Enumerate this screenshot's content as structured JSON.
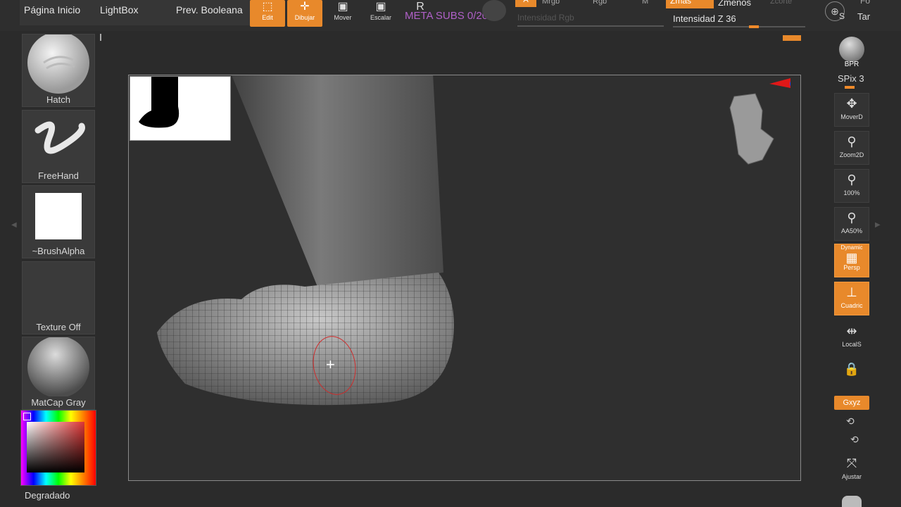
{
  "topbar": {
    "home_label": "Página Inicio",
    "lightbox_label": "LightBox",
    "bool_label": "Prev. Booleana",
    "tools": [
      {
        "label": "Edit",
        "icon": "edit-icon"
      },
      {
        "label": "Dibujar",
        "icon": "draw-icon"
      },
      {
        "label": "Mover",
        "icon": "move-icon"
      },
      {
        "label": "Escalar",
        "icon": "scale-icon"
      },
      {
        "label": "R",
        "icon": "rotate-icon"
      }
    ],
    "meta_subs": "META SUBS 0/20",
    "a_label": "A",
    "mrgb_label": "Mrgb",
    "rgb_label": "Rgb",
    "m_label": "M",
    "intensity_rgb": "Intensidad Rgb",
    "zmas_label": "Zmas",
    "zmenos_label": "Zmenos",
    "zcorte_label": "Zcorte",
    "intensity_z": "Intensidad Z 36",
    "right_cut_1": "Fo",
    "right_cut_2": "Tar",
    "s_label": "S"
  },
  "left_panel": {
    "hatch": "Hatch",
    "freehand": "FreeHand",
    "brush_alpha": "~BrushAlpha",
    "texture": "Texture Off",
    "matcap": "MatCap Gray",
    "gradient": "Degradado"
  },
  "right_panel": {
    "bpr": "BPR",
    "spix": "SPix 3",
    "buttons": [
      {
        "label": "MoverD",
        "icon": "move-doc-icon"
      },
      {
        "label": "Zoom2D",
        "icon": "zoom2d-icon"
      },
      {
        "label": "100%",
        "icon": "zoom100-icon"
      },
      {
        "label": "AA50%",
        "icon": "aa50-icon"
      },
      {
        "label": "Persp",
        "top": "Dynamic",
        "icon": "perspective-icon"
      },
      {
        "label": "Cuadric",
        "icon": "floor-grid-icon"
      },
      {
        "label": "LocalS",
        "icon": "local-symmetry-icon"
      },
      {
        "label": "",
        "icon": "lock-icon"
      }
    ],
    "xyz_label": "Gxyz",
    "fit_label": "Ajustar"
  },
  "colors": {
    "accent": "#e8892b",
    "panel": "#2b2b2b",
    "meta_text": "#b060c8"
  }
}
